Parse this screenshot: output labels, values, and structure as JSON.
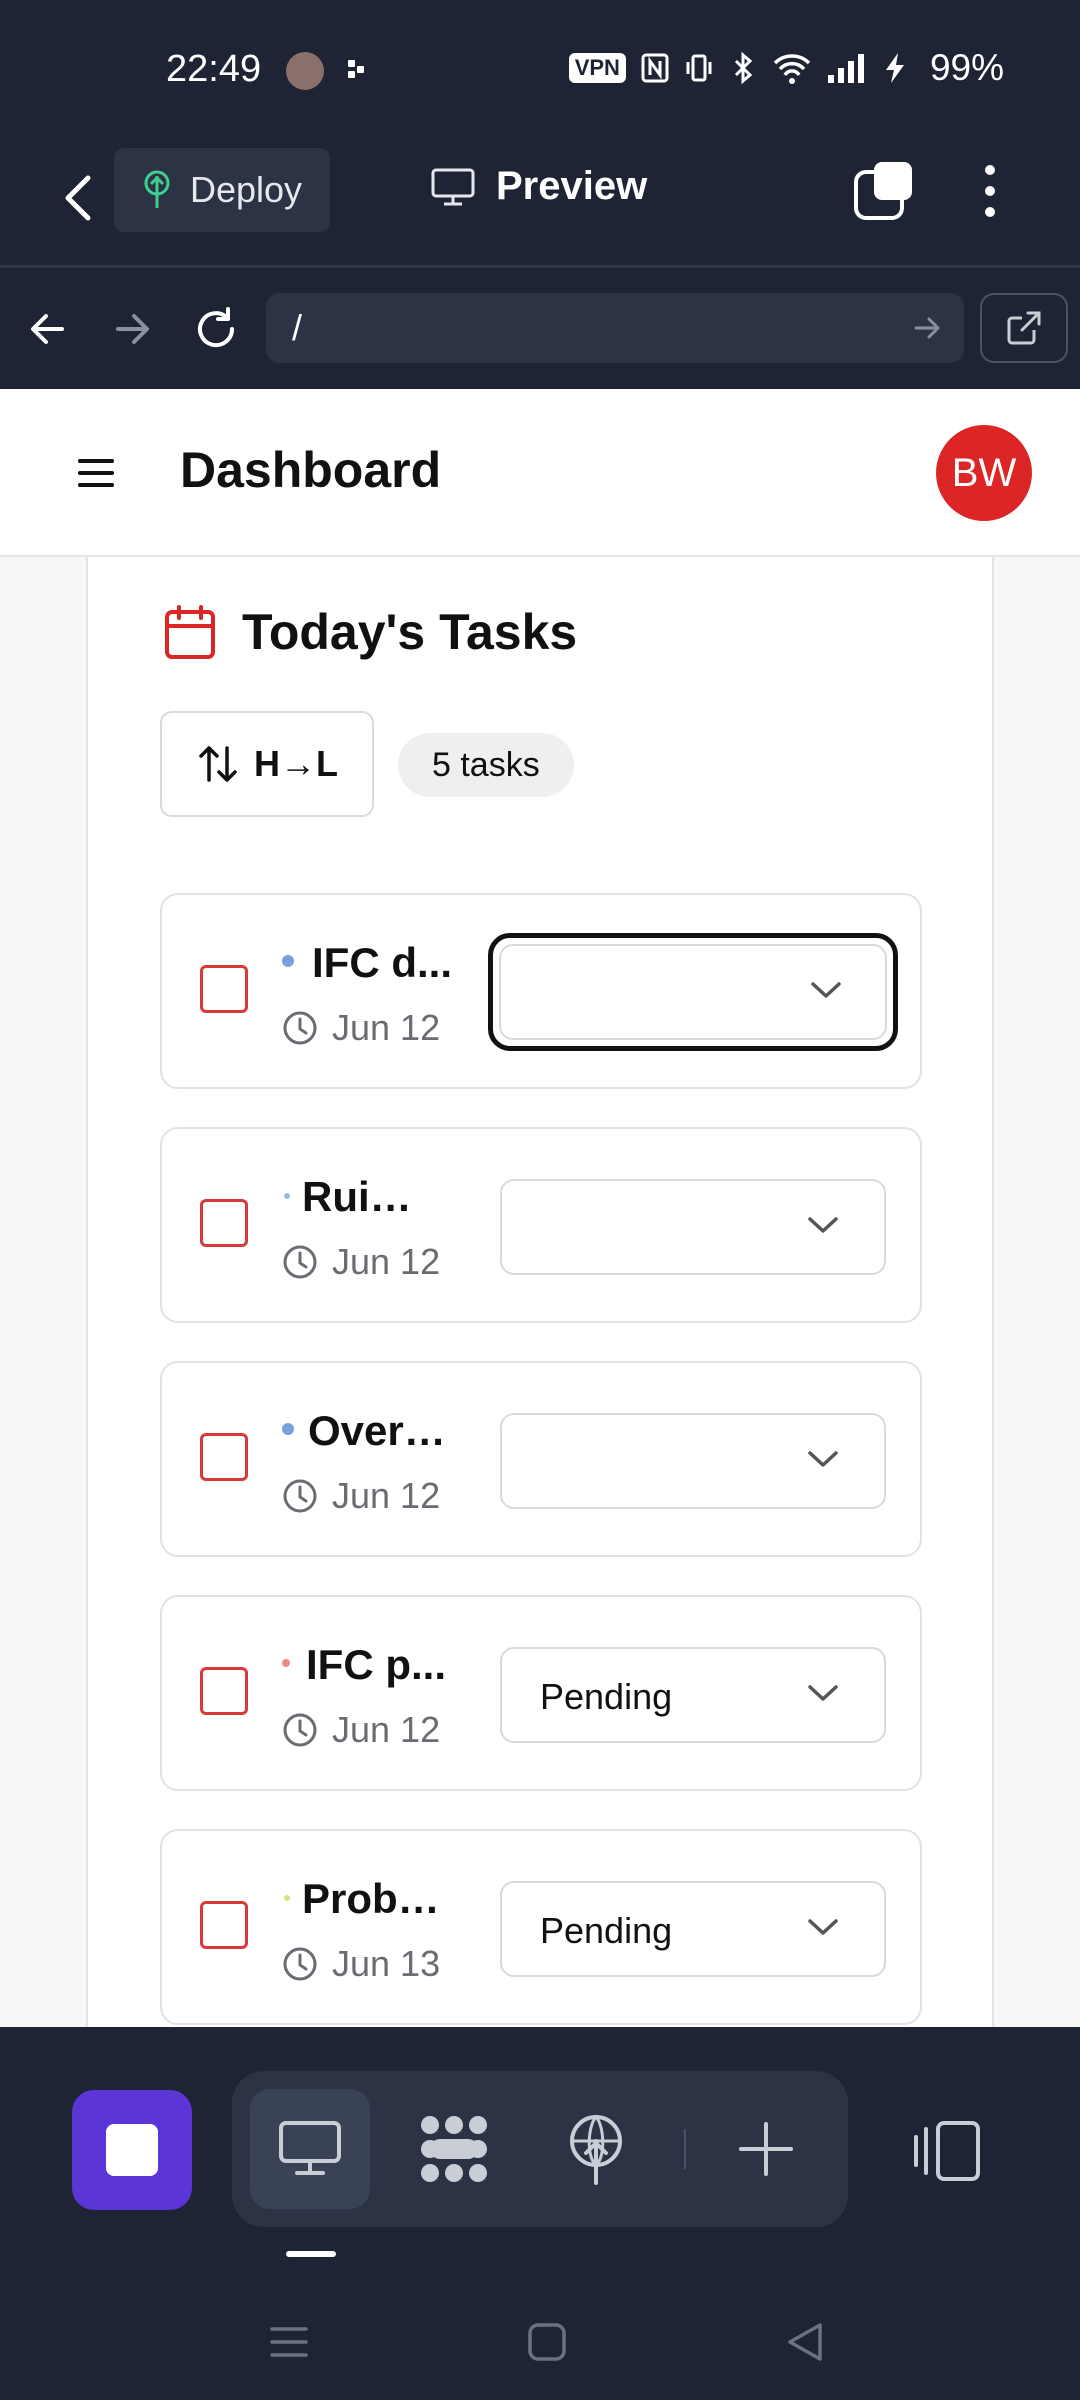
{
  "status_bar": {
    "time": "22:49",
    "vpn": "VPN",
    "battery": "99%"
  },
  "app_bar": {
    "deploy_label": "Deploy",
    "preview_label": "Preview"
  },
  "browser": {
    "url": "/"
  },
  "page": {
    "title": "Dashboard",
    "user_initials": "BW"
  },
  "tasks_panel": {
    "title": "Today's Tasks",
    "sort_label": "H→L",
    "count_label": "5 tasks",
    "tasks": [
      {
        "name": "IFC d...",
        "due": "Jun 12",
        "status": "",
        "priority_color": "#7aa0dc"
      },
      {
        "name": "Ruimt...",
        "due": "Jun 12",
        "status": "",
        "priority_color": "#9ab8e6"
      },
      {
        "name": "Overz...",
        "due": "Jun 12",
        "status": "",
        "priority_color": "#7aa0dc"
      },
      {
        "name": "IFC p...",
        "due": "Jun 12",
        "status": "Pending",
        "priority_color": "#f08a8a"
      },
      {
        "name": "Probl...",
        "due": "Jun 13",
        "status": "Pending",
        "priority_color": "#d6e27a"
      }
    ]
  },
  "colors": {
    "checkbox_border": "#d83a3a",
    "avatar_bg": "#dc2626",
    "calendar_icon": "#dc2626",
    "stop_button": "#5b35d5",
    "chrome_bg": "#1e2433"
  }
}
